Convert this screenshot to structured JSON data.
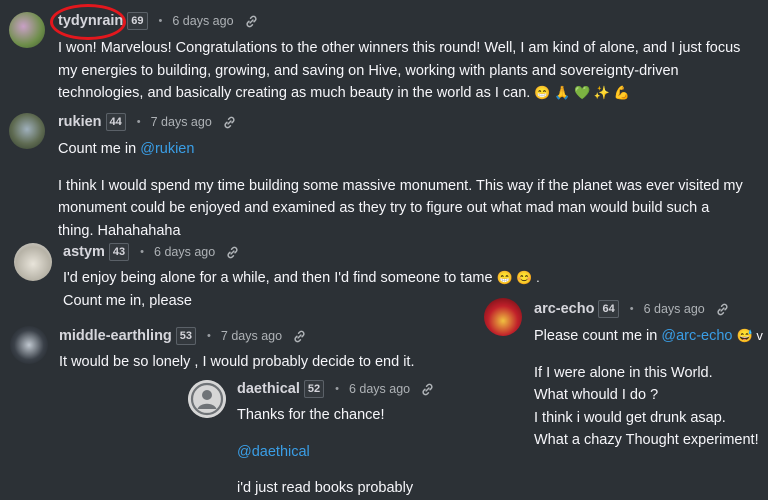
{
  "comments": [
    {
      "author": "tydynrain",
      "rep": "69",
      "time": "6 days ago",
      "text": "I won! Marvelous! Congratulations to the other winners this round! Well, I am kind of alone, and I just focus my energies to building, growing, and saving on Hive, working with plants and sovereignty-driven technologies, and basically creating as much beauty in the world as I can.",
      "emojis": "😁 🙏 💚 ✨ 💪"
    },
    {
      "author": "rukien",
      "rep": "44",
      "time": "7 days ago",
      "line1": "Count me in ",
      "mention": "@rukien",
      "text": "I think I would spend my time building some massive monument. This way if the planet was ever visited my monument could be enjoyed and examined as they try to figure out what mad man would build such a thing. Hahahahaha"
    },
    {
      "author": "astym",
      "rep": "43",
      "time": "6 days ago",
      "line1": "I'd enjoy being alone for a while, and then I'd find someone to tame",
      "emojis": "😁 😊 .",
      "line2": "Count me in, please"
    },
    {
      "author": "arc-echo",
      "rep": "64",
      "time": "6 days ago",
      "line1": "Please count me in ",
      "mention": "@arc-echo",
      "emojis": "😅 v",
      "lines": [
        "If I were alone in this World.",
        "What whould I do ?",
        "I think i would get drunk asap.",
        "What a chazy Thought experiment!"
      ]
    },
    {
      "author": "middle-earthling",
      "rep": "53",
      "time": "7 days ago",
      "text": "It would be so lonely , I would probably decide to end it."
    },
    {
      "author": "daethical",
      "rep": "52",
      "time": "6 days ago",
      "line1": "Thanks for the chance!",
      "mention": "@daethical",
      "line3": "i'd just read books probably"
    }
  ],
  "colors": {
    "background": "#2c3136",
    "mention": "#3a9ee6",
    "highlight_circle": "#e3171d"
  }
}
